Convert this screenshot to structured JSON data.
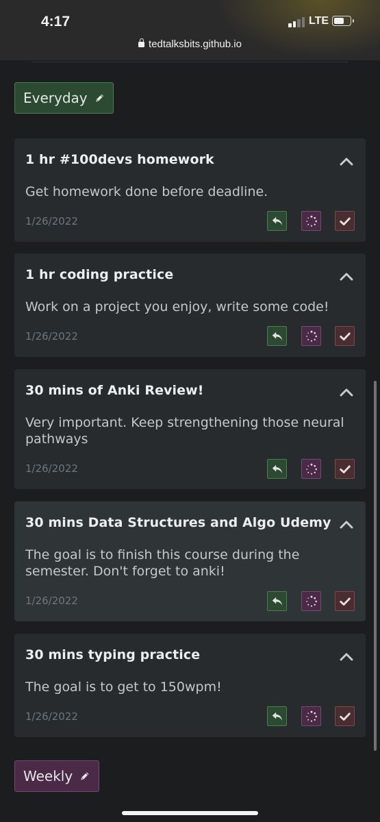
{
  "status_bar": {
    "time": "4:17",
    "network": "LTE",
    "url": "tedtalksbits.github.io"
  },
  "groups": [
    {
      "label": "Everyday",
      "color": "#2c4a31"
    },
    {
      "label": "Weekly",
      "color": "#4a2a47"
    }
  ],
  "tasks": [
    {
      "title": "1 hr #100devs homework",
      "description": "Get homework done before deadline.",
      "date": "1/26/2022"
    },
    {
      "title": "1 hr coding practice",
      "description": "Work on a project you enjoy, write some code!",
      "date": "1/26/2022"
    },
    {
      "title": "30 mins of Anki Review!",
      "description": "Very important. Keep strengthening those neural pathways",
      "date": "1/26/2022"
    },
    {
      "title": "30 mins Data Structures and Algo Udemy",
      "description": "The goal is to finish this course during the semester. Don't forget to anki!",
      "date": "1/26/2022"
    },
    {
      "title": "30 mins typing practice",
      "description": "The goal is to get to 150wpm!",
      "date": "1/26/2022"
    }
  ],
  "icons": {
    "edit": "pencil-icon",
    "collapse": "chevron-up-icon",
    "reset": "reply-arrow-icon",
    "in_progress": "spinner-icon",
    "done": "checkmark-icon"
  },
  "colors": {
    "background": "#1b1d1e",
    "card": "#272b2e",
    "green": "#2c4a31",
    "purple": "#4a2a47",
    "red": "#4a2d31"
  }
}
